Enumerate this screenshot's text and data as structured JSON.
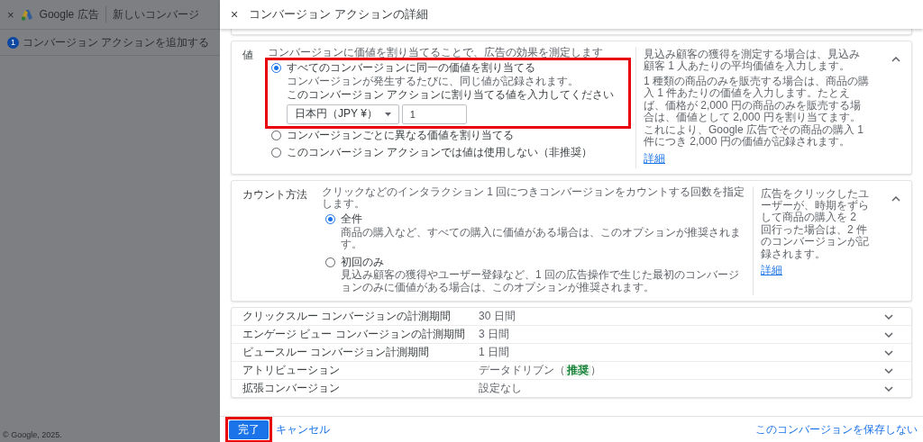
{
  "background": {
    "close": "×",
    "product": "Google 広告",
    "page_title": "新しいコンバージ",
    "steps": [
      {
        "number": "1",
        "label": "コンバージョン アクションを追加する",
        "selected": true
      }
    ],
    "copyright": "© Google, 2025."
  },
  "panel": {
    "close": "×",
    "title": "コンバージョン アクションの詳細"
  },
  "cards": [
    {
      "label": "値",
      "expanded": true,
      "description": "コンバージョンに価値を割り当てることで、広告の効果を測定します",
      "options": [
        {
          "label": "すべてのコンバージョンに同一の価値を割り当てる",
          "sub": "コンバージョンが発生するたびに、同じ値が記録されます。",
          "selected": true,
          "highlighted": true,
          "prompt": "このコンバージョン アクションに割り当てる値を入力してください",
          "currency": "日本円（JPY ¥）",
          "amount": "1"
        },
        {
          "label": "コンバージョンごとに異なる価値を割り当てる",
          "selected": false,
          "highlighted": false
        },
        {
          "label": "このコンバージョン アクションでは値は使用しない（非推奨）",
          "selected": false,
          "highlighted": false
        }
      ],
      "help": [
        "見込み顧客の獲得を測定する場合は、見込み顧客 1 人あたりの平均価値を入力します。",
        "1 種類の商品のみを販売する場合は、商品の購入 1 件あたりの価値を入力します。たとえば、価格が 2,000 円の商品のみを販売する場合は、価値として 2,000 円を割り当てます。これにより、Google 広告でその商品の購入 1 件につき 2,000 円の価値が記録されます。"
      ],
      "help_link": "詳細"
    },
    {
      "label": "カウント方法",
      "expanded": true,
      "description": "クリックなどのインタラクション 1 回につきコンバージョンをカウントする回数を指定します。",
      "options": [
        {
          "label": "全件",
          "sub": "商品の購入など、すべての購入に価値がある場合は、このオプションが推奨されます。",
          "selected": true,
          "highlighted": false
        },
        {
          "label": "初回のみ",
          "sub": "見込み顧客の獲得やユーザー登録など、1 回の広告操作で生じた最初のコンバージョンのみに価値がある場合は、このオプションが推奨されます。",
          "selected": false,
          "highlighted": false
        }
      ],
      "help": [
        "広告をクリックしたユーザーが、時期をずらして商品の購入を 2 回行った場合は、2 件のコンバージョンが記録されます。"
      ],
      "help_link": "詳細"
    }
  ],
  "rows": [
    {
      "label": "クリックスルー コンバージョンの計測期間",
      "value": "30 日間",
      "expanded": false
    },
    {
      "label": "エンゲージ ビュー コンバージョンの計測期間",
      "value": "3 日間",
      "expanded": false
    },
    {
      "label": "ビュースルー コンバージョン計測期間",
      "value": "1 日間",
      "expanded": false
    },
    {
      "label": "アトリビューション",
      "value": "データドリブン（",
      "badge": "推奨",
      "value_end": "）",
      "expanded": false
    },
    {
      "label": "拡張コンバージョン",
      "value": "設定なし",
      "expanded": false
    }
  ],
  "footer": {
    "done": {
      "label": "完了",
      "highlighted": true
    },
    "cancel": "キャンセル",
    "discard": "このコンバージョンを保存しない"
  }
}
